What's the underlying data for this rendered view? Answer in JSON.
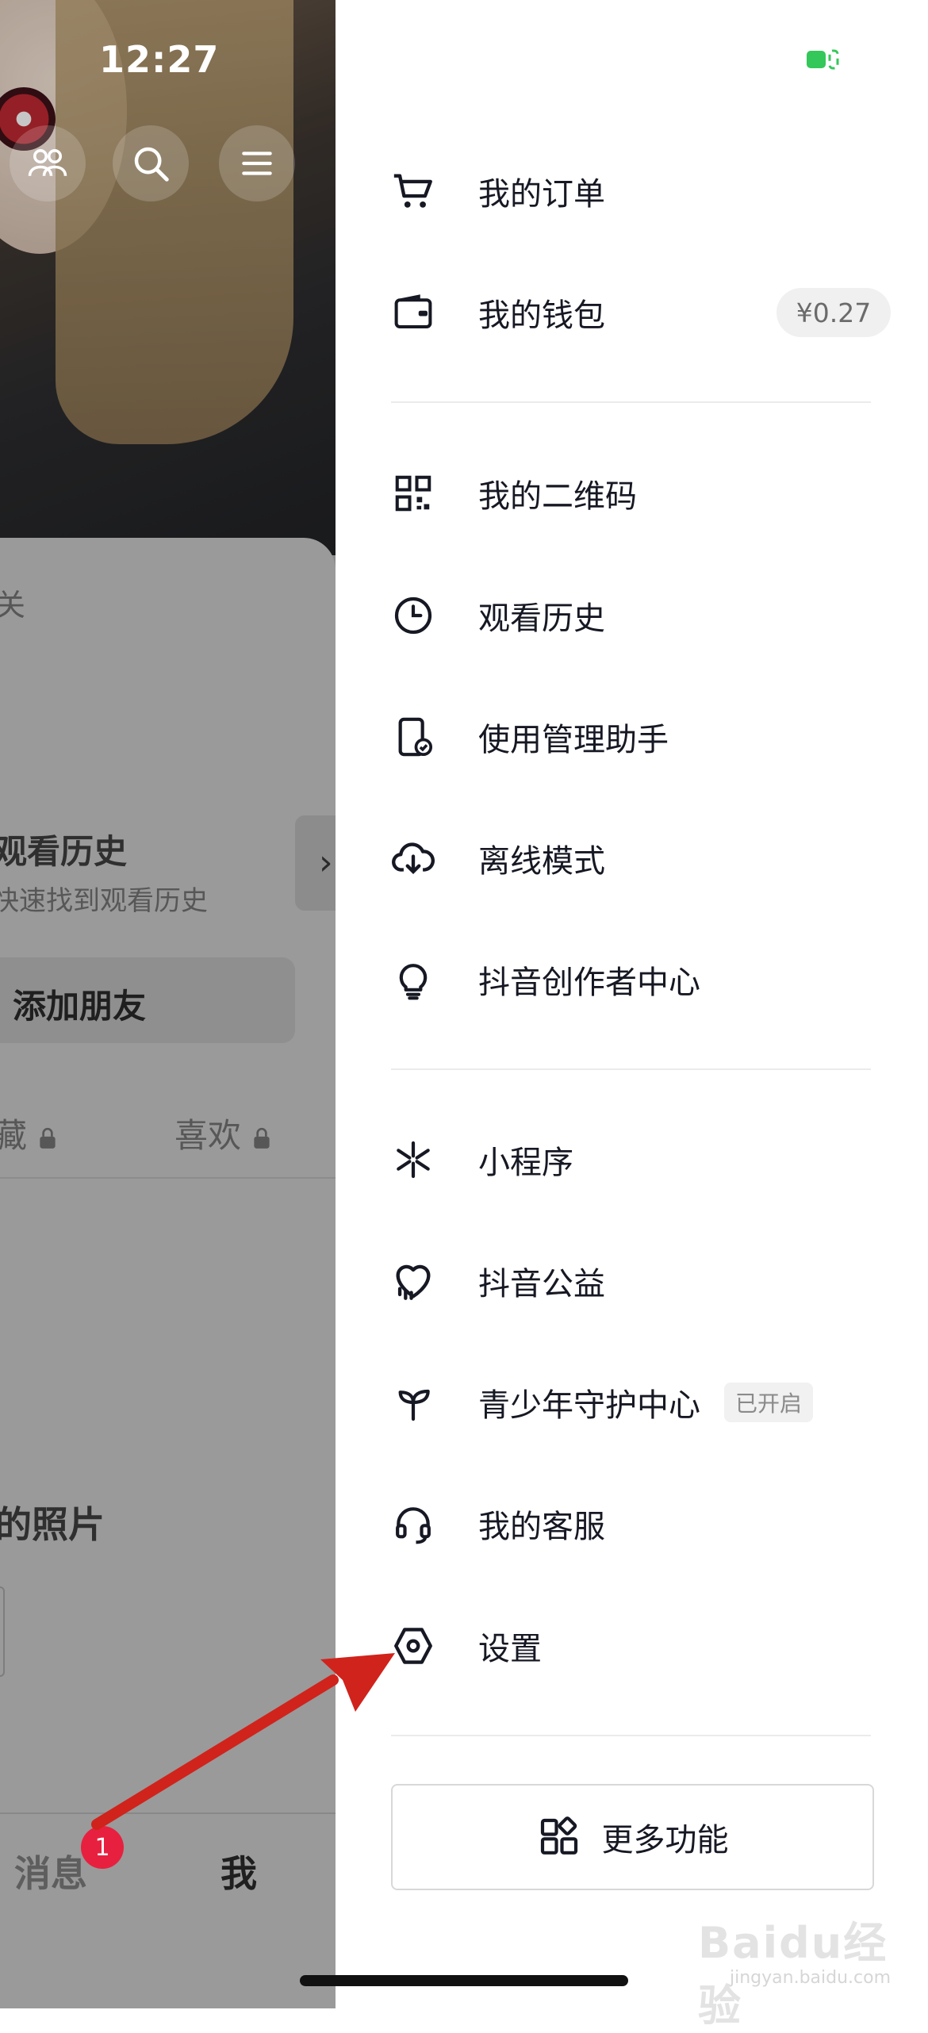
{
  "status_bar": {
    "time": "12:27"
  },
  "background_page": {
    "partial_label_top": "关",
    "history_title": "观看历史",
    "history_subtitle": "快速找到观看历史",
    "add_friend": "添加朋友",
    "tabs": [
      "藏",
      "喜欢"
    ],
    "photo_title": "的照片",
    "nav": {
      "messages": "消息",
      "me": "我",
      "badge": "1"
    }
  },
  "drawer": {
    "group1": [
      {
        "label": "我的订单",
        "icon": "cart-icon"
      },
      {
        "label": "我的钱包",
        "icon": "wallet-icon",
        "badge": "¥0.27"
      }
    ],
    "group2": [
      {
        "label": "我的二维码",
        "icon": "qr-code-icon"
      },
      {
        "label": "观看历史",
        "icon": "clock-icon"
      },
      {
        "label": "使用管理助手",
        "icon": "phone-check-icon"
      },
      {
        "label": "离线模式",
        "icon": "cloud-download-icon"
      },
      {
        "label": "抖音创作者中心",
        "icon": "lightbulb-icon"
      }
    ],
    "group3": [
      {
        "label": "小程序",
        "icon": "mini-program-icon"
      },
      {
        "label": "抖音公益",
        "icon": "charity-heart-icon"
      },
      {
        "label": "青少年守护中心",
        "icon": "sprout-icon",
        "tag": "已开启"
      },
      {
        "label": "我的客服",
        "icon": "headset-icon"
      },
      {
        "label": "设置",
        "icon": "settings-hex-icon"
      }
    ],
    "more_button": "更多功能"
  },
  "watermark": {
    "text": "Baidu经验",
    "sub": "jingyan.baidu.com"
  },
  "colors": {
    "annotation_arrow": "#d0231c",
    "badge_red": "#e8203f",
    "battery_green": "#34c759"
  }
}
